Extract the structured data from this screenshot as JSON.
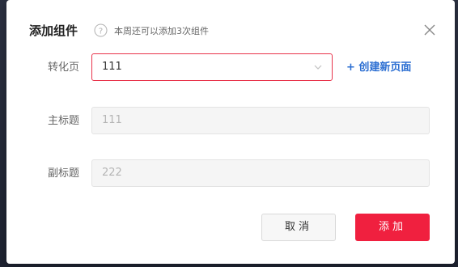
{
  "dialog": {
    "title": "添加组件",
    "hint": "本周还可以添加3次组件",
    "icons": {
      "help": "help-circle-icon",
      "close": "close-icon",
      "dropdown": "chevron-down-icon"
    }
  },
  "form": {
    "conversion_page": {
      "label": "转化页",
      "value": "111"
    },
    "create_link": "+ 创建新页面",
    "main_title": {
      "label": "主标题",
      "value": "111"
    },
    "sub_title": {
      "label": "副标题",
      "value": "222"
    }
  },
  "buttons": {
    "cancel": "取消",
    "add": "添加"
  },
  "colors": {
    "accent": "#f0203f",
    "link": "#2b6ed2",
    "select_border": "#e8334a"
  }
}
